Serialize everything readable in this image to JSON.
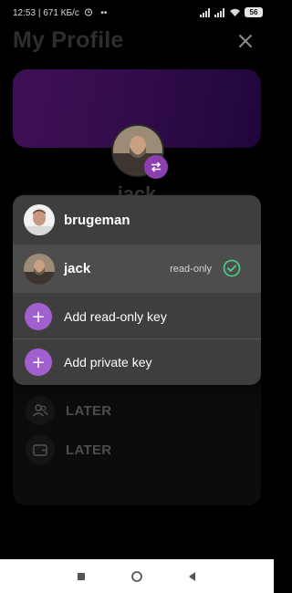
{
  "status_bar": {
    "time": "12:53",
    "speed": "671 КБ/с",
    "dots": "••",
    "battery": "56"
  },
  "header": {
    "title": "My Profile"
  },
  "profile": {
    "name_partial": "jack"
  },
  "background_items": [
    {
      "label": "LATER",
      "icon": "people-icon"
    },
    {
      "label": "LATER",
      "icon": "wallet-icon"
    }
  ],
  "account_menu": {
    "accounts": [
      {
        "name": "brugeman",
        "active": false
      },
      {
        "name": "jack",
        "active": true,
        "badge": "read-only"
      }
    ],
    "actions": [
      {
        "label": "Add read-only key",
        "icon": "+"
      },
      {
        "label": "Add private key",
        "icon": "+"
      }
    ]
  },
  "colors": {
    "accent": "#a25fd0",
    "menu_bg": "#3e3e3e",
    "active_row": "#4d4d4d",
    "check": "#4fd18b"
  }
}
